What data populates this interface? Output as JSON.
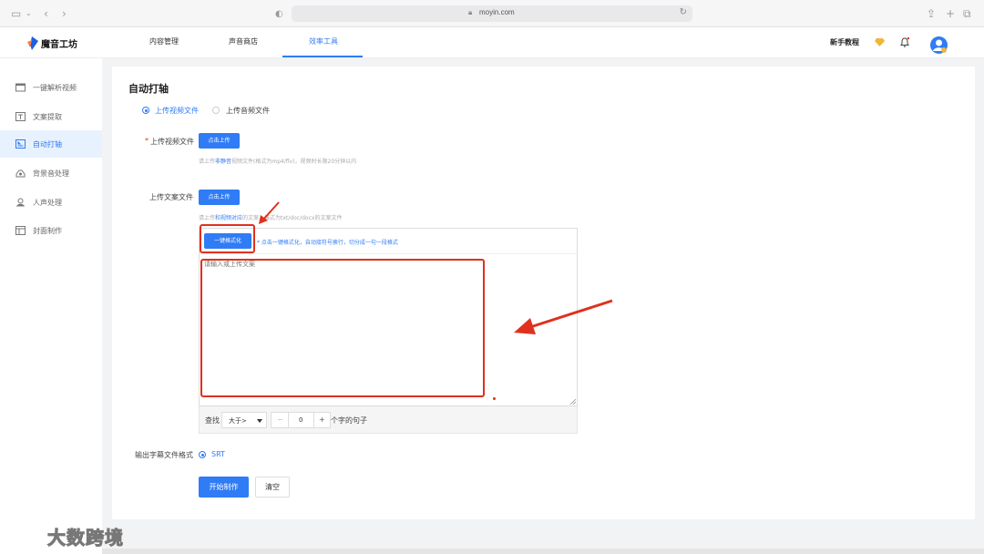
{
  "browser": {
    "url": "moyin.com"
  },
  "header": {
    "logo_text": "魔音工坊",
    "nav": [
      "内容管理",
      "声音商店",
      "效率工具"
    ],
    "tutorial": "新手教程"
  },
  "sidebar": {
    "items": [
      {
        "label": "一键解析视频"
      },
      {
        "label": "文案提取"
      },
      {
        "label": "自动打轴"
      },
      {
        "label": "背景音处理"
      },
      {
        "label": "人声处理"
      },
      {
        "label": "封面制作"
      }
    ]
  },
  "main": {
    "title": "自动打轴",
    "upload_type": {
      "option1": "上传视频文件",
      "option2": "上传音频文件"
    },
    "video": {
      "label": "上传视频文件",
      "button": "点击上传",
      "hint_pre": "请上传",
      "hint_em": "非静音",
      "hint_post": "视频文件(格式为mp4/flv)，视频时长限20分钟以内"
    },
    "script": {
      "label": "上传文案文件",
      "button": "点击上传",
      "hint_pre": "请上传",
      "hint_em": "和视频对应",
      "hint_post": "的文案，格式为txt/doc/docx的文案文件"
    },
    "format_button": "一键格式化",
    "format_hint": "* 点击一键格式化，自动接符号换行，切分成一句一段格式",
    "editor_placeholder": "请输入或上传文案",
    "find": {
      "label": "查找",
      "select_value": "大于>",
      "minus": "−",
      "value": "0",
      "plus": "+",
      "suffix": "个字的句子"
    },
    "output": {
      "label": "输出字幕文件格式",
      "option": "SRT"
    },
    "start_button": "开始制作",
    "clear_button": "清空"
  },
  "watermark": "大数跨境",
  "colors": {
    "accent": "#2f7cf6",
    "annotation_red": "#e0301e"
  }
}
